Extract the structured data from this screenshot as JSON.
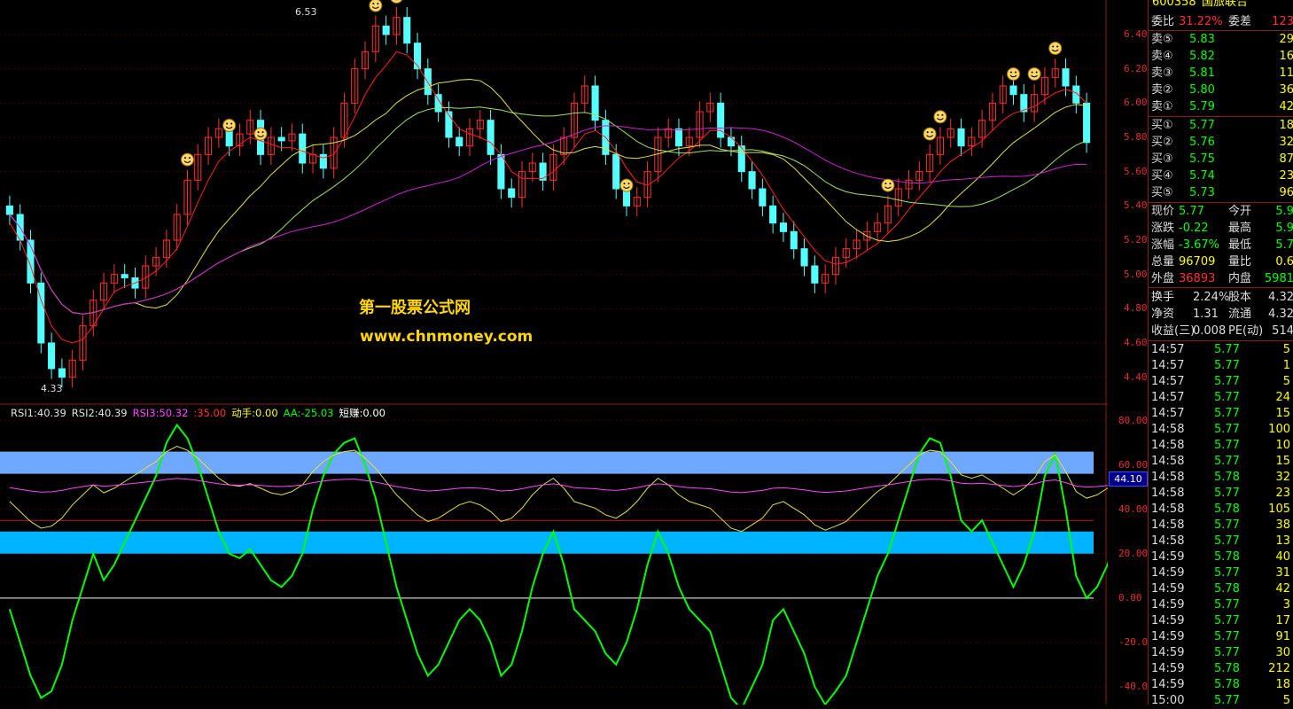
{
  "price_axis": [
    "6.40",
    "6.20",
    "6.00",
    "5.80",
    "5.60",
    "5.40",
    "5.20",
    "5.00",
    "4.80",
    "4.60",
    "4.40"
  ],
  "indicator_axis": [
    "80.00",
    "60.00",
    "40.00",
    "20.00",
    "0.00",
    "-20.00",
    "-40.00"
  ],
  "price_annotations": {
    "high": "6.53",
    "low": "4.33"
  },
  "indicator_legend": [
    {
      "text": "RSI1:40.39",
      "color": "#e0e0e0"
    },
    {
      "text": "RSI2:40.39",
      "color": "#e0e0e0"
    },
    {
      "text": "RSI3:50.32",
      "color": "#ff44ff"
    },
    {
      "text": ":35.00",
      "color": "#ff3030"
    },
    {
      "text": "动手:0.00",
      "color": "#ffff00"
    },
    {
      "text": "AA:-25.03",
      "color": "#00ff00"
    },
    {
      "text": "短赚:0.00",
      "color": "#ffffff"
    }
  ],
  "indicator_cursor_value": "44.10",
  "watermark": {
    "line1": "第一股票公式网",
    "line2": "www.chnmoney.com"
  },
  "quote_header": {
    "code": "600358",
    "name": "国旅联合"
  },
  "order_ratio": {
    "label1": "委比",
    "value1": "31.22%",
    "label2": "委差",
    "value2": "123"
  },
  "sell_orders": [
    {
      "label": "卖⑤",
      "price": "5.83",
      "volume": "29"
    },
    {
      "label": "卖④",
      "price": "5.82",
      "volume": "16"
    },
    {
      "label": "卖③",
      "price": "5.81",
      "volume": "11"
    },
    {
      "label": "卖②",
      "price": "5.80",
      "volume": "36"
    },
    {
      "label": "卖①",
      "price": "5.79",
      "volume": "42"
    }
  ],
  "buy_orders": [
    {
      "label": "买①",
      "price": "5.77",
      "volume": "18"
    },
    {
      "label": "买②",
      "price": "5.76",
      "volume": "32"
    },
    {
      "label": "买③",
      "price": "5.75",
      "volume": "87"
    },
    {
      "label": "买④",
      "price": "5.74",
      "volume": "23"
    },
    {
      "label": "买⑤",
      "price": "5.73",
      "volume": "96"
    }
  ],
  "stats": [
    {
      "l1": "现价",
      "v1": "5.77",
      "c1": "green",
      "l2": "今开",
      "v2": "5.9",
      "c2": "green"
    },
    {
      "l1": "涨跌",
      "v1": "-0.22",
      "c1": "green",
      "l2": "最高",
      "v2": "5.9",
      "c2": "green"
    },
    {
      "l1": "涨幅",
      "v1": "-3.67%",
      "c1": "green",
      "l2": "最低",
      "v2": "5.7",
      "c2": "green"
    },
    {
      "l1": "总量",
      "v1": "96709",
      "c1": "yellow",
      "l2": "量比",
      "v2": "0.6",
      "c2": "yellow"
    },
    {
      "l1": "外盘",
      "v1": "36893",
      "c1": "red",
      "l2": "内盘",
      "v2": "5981",
      "c2": "green"
    }
  ],
  "stats2": [
    {
      "l1": "换手",
      "v1": "2.24%",
      "l2": "股本",
      "v2": "4.32"
    },
    {
      "l1": "净资",
      "v1": "1.31",
      "l2": "流通",
      "v2": "4.32"
    },
    {
      "l1": "收益(三)",
      "v1": "0.008",
      "l2": "PE(动)",
      "v2": "514"
    }
  ],
  "trades": [
    {
      "time": "14:57",
      "price": "5.77",
      "volume": "5"
    },
    {
      "time": "14:57",
      "price": "5.77",
      "volume": "1"
    },
    {
      "time": "14:57",
      "price": "5.77",
      "volume": "5"
    },
    {
      "time": "14:57",
      "price": "5.77",
      "volume": "24"
    },
    {
      "time": "14:57",
      "price": "5.77",
      "volume": "15"
    },
    {
      "time": "14:58",
      "price": "5.77",
      "volume": "100"
    },
    {
      "time": "14:58",
      "price": "5.77",
      "volume": "10"
    },
    {
      "time": "14:58",
      "price": "5.77",
      "volume": "15"
    },
    {
      "time": "14:58",
      "price": "5.78",
      "volume": "32"
    },
    {
      "time": "14:58",
      "price": "5.77",
      "volume": "23"
    },
    {
      "time": "14:58",
      "price": "5.78",
      "volume": "105"
    },
    {
      "time": "14:58",
      "price": "5.77",
      "volume": "38"
    },
    {
      "time": "14:58",
      "price": "5.77",
      "volume": "13"
    },
    {
      "time": "14:59",
      "price": "5.78",
      "volume": "40"
    },
    {
      "time": "14:59",
      "price": "5.77",
      "volume": "31"
    },
    {
      "time": "14:59",
      "price": "5.78",
      "volume": "42"
    },
    {
      "time": "14:59",
      "price": "5.77",
      "volume": "3"
    },
    {
      "time": "14:59",
      "price": "5.77",
      "volume": "17"
    },
    {
      "time": "14:59",
      "price": "5.77",
      "volume": "91"
    },
    {
      "time": "14:59",
      "price": "5.77",
      "volume": "30"
    },
    {
      "time": "14:59",
      "price": "5.78",
      "volume": "212"
    },
    {
      "time": "14:59",
      "price": "5.78",
      "volume": "18"
    },
    {
      "time": "15:00",
      "price": "5.77",
      "volume": "5"
    }
  ],
  "colors": {
    "up_candle": "#ff3030",
    "down_candle": "#54ffff",
    "ma_red": "#ff2020",
    "ma_yellow": "#e0e040",
    "ma_green": "#a0e060",
    "ma_magenta": "#d020d0",
    "aa_line": "#00ff00",
    "rsi_line": "#e0e040",
    "rsi3_line": "#ff44ff",
    "band_light": "#6fa8ff",
    "band_cyan": "#00b4ff"
  },
  "chart_data": {
    "type": "candlestick",
    "price_range": [
      4.3,
      6.55
    ],
    "indicator_range": [
      -48,
      85
    ],
    "closes": [
      5.35,
      5.2,
      4.95,
      4.6,
      4.45,
      4.4,
      4.5,
      4.7,
      4.85,
      4.95,
      5.0,
      4.98,
      4.92,
      5.05,
      5.1,
      5.2,
      5.35,
      5.55,
      5.7,
      5.8,
      5.85,
      5.75,
      5.82,
      5.9,
      5.7,
      5.8,
      5.78,
      5.82,
      5.65,
      5.7,
      5.62,
      5.8,
      6.0,
      6.2,
      6.3,
      6.45,
      6.4,
      6.5,
      6.35,
      6.2,
      6.05,
      5.95,
      5.8,
      5.75,
      5.85,
      5.9,
      5.7,
      5.5,
      5.45,
      5.6,
      5.65,
      5.55,
      5.7,
      5.8,
      6.0,
      6.1,
      5.9,
      5.7,
      5.5,
      5.4,
      5.45,
      5.6,
      5.8,
      5.85,
      5.75,
      5.8,
      5.95,
      6.0,
      5.8,
      5.75,
      5.6,
      5.5,
      5.4,
      5.3,
      5.25,
      5.15,
      5.05,
      4.95,
      5.0,
      5.1,
      5.15,
      5.2,
      5.25,
      5.3,
      5.4,
      5.5,
      5.55,
      5.6,
      5.7,
      5.8,
      5.85,
      5.75,
      5.8,
      5.9,
      6.0,
      6.1,
      6.05,
      5.95,
      6.05,
      6.15,
      6.2,
      6.1,
      6.0,
      5.77
    ],
    "ma_red": [
      5.3,
      5.2,
      5.05,
      4.85,
      4.7,
      4.62,
      4.6,
      4.62,
      4.7,
      4.8,
      4.9,
      4.93,
      4.95,
      4.98,
      5.02,
      5.08,
      5.15,
      5.28,
      5.42,
      5.55,
      5.66,
      5.72,
      5.76,
      5.8,
      5.78,
      5.76,
      5.74,
      5.74,
      5.72,
      5.7,
      5.68,
      5.7,
      5.8,
      5.92,
      6.05,
      6.15,
      6.22,
      6.3,
      6.28,
      6.22,
      6.12,
      6.02,
      5.93,
      5.85,
      5.82,
      5.8,
      5.77,
      5.7,
      5.6,
      5.56,
      5.56,
      5.56,
      5.6,
      5.66,
      5.74,
      5.82,
      5.84,
      5.8,
      5.72,
      5.62,
      5.54,
      5.52,
      5.56,
      5.62,
      5.68,
      5.72,
      5.78,
      5.84,
      5.84,
      5.8,
      5.74,
      5.66,
      5.58,
      5.48,
      5.38,
      5.3,
      5.22,
      5.14,
      5.08,
      5.06,
      5.07,
      5.1,
      5.14,
      5.18,
      5.24,
      5.3,
      5.38,
      5.45,
      5.52,
      5.6,
      5.66,
      5.7,
      5.74,
      5.78,
      5.84,
      5.9,
      5.94,
      5.96,
      5.98,
      6.02,
      6.06,
      6.08,
      6.06,
      6.0
    ],
    "aa": [
      -5,
      -20,
      -35,
      -45,
      -42,
      -30,
      -10,
      5,
      20,
      8,
      15,
      25,
      35,
      45,
      55,
      70,
      78,
      72,
      60,
      45,
      30,
      20,
      18,
      22,
      15,
      8,
      5,
      10,
      20,
      40,
      55,
      65,
      70,
      72,
      60,
      45,
      25,
      5,
      -10,
      -25,
      -35,
      -30,
      -20,
      -10,
      -5,
      -10,
      -20,
      -35,
      -30,
      -15,
      5,
      20,
      30,
      15,
      -5,
      -10,
      -15,
      -25,
      -30,
      -20,
      -5,
      15,
      30,
      20,
      5,
      -5,
      -10,
      -15,
      -30,
      -45,
      -50,
      -40,
      -30,
      -10,
      -5,
      -15,
      -25,
      -40,
      -48,
      -42,
      -35,
      -20,
      -5,
      10,
      20,
      35,
      50,
      65,
      72,
      70,
      55,
      35,
      30,
      35,
      25,
      15,
      5,
      15,
      30,
      55,
      65,
      40,
      10,
      0,
      5,
      15,
      30,
      20,
      25,
      -25
    ]
  }
}
